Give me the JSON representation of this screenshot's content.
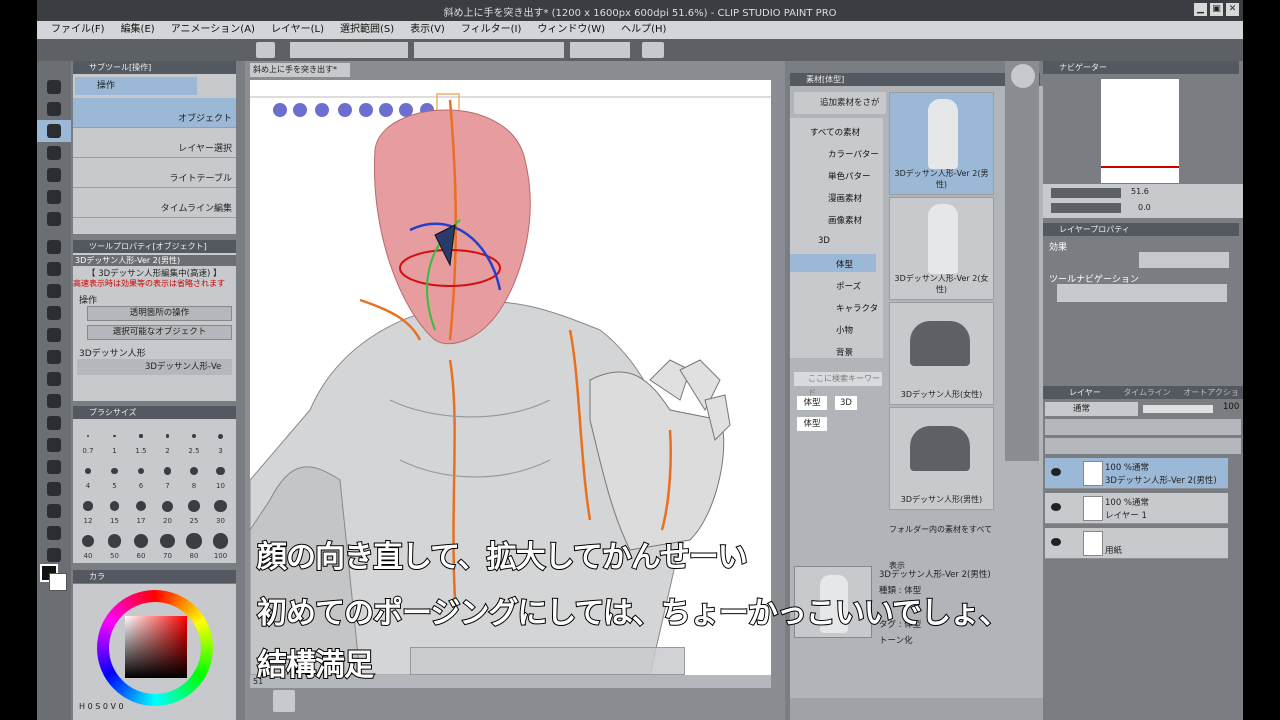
{
  "window": {
    "title": "斜め上に手を突き出す* (1200 x 1600px 600dpi 51.6%) - CLIP STUDIO PAINT PRO"
  },
  "menu": [
    "ファイル(F)",
    "編集(E)",
    "アニメーション(A)",
    "レイヤー(L)",
    "選択範囲(S)",
    "表示(V)",
    "フィルター(I)",
    "ウィンドウ(W)",
    "ヘルプ(H)"
  ],
  "subtool_panel": {
    "tab": "サブツール[操作]",
    "group": "操作",
    "items": [
      "オブジェクト",
      "レイヤー選択",
      "ライトテーブル",
      "タイムライン編集"
    ]
  },
  "tool_property": {
    "tab": "ツールプロパティ[オブジェクト]",
    "model_name": "3Dデッサン人形-Ver 2(男性)",
    "status_line1": "【 3Dデッサン人形編集中(高速) 】",
    "status_line2": "高速表示時は効果等の表示は省略されます",
    "section_operation": "操作",
    "btn_transparent": "透明箇所の操作",
    "btn_selectable": "選択可能なオブジェクト",
    "section_doll": "3Dデッサン人形",
    "doll_row": "3Dデッサン人形-Ve"
  },
  "brush_size": {
    "tab": "ブラシサイズ",
    "values": [
      "0.7",
      "1",
      "1.5",
      "2",
      "2.5",
      "3",
      "4",
      "5",
      "6",
      "7",
      "8",
      "10",
      "12",
      "15",
      "17",
      "20",
      "25",
      "30",
      "40",
      "50",
      "60",
      "70",
      "80",
      "100"
    ]
  },
  "color_panel": {
    "tab": "カラ",
    "h": "0",
    "s": "0",
    "v": "0"
  },
  "canvas_tab": "斜め上に手を突き出す*",
  "canvas_zoom": "51",
  "materials": {
    "tab": "素材[体型]",
    "search_button": "追加素材をさがす",
    "tree": [
      "すべての素材",
      "カラーパター",
      "単色パター",
      "漫画素材",
      "画像素材",
      "3D",
      "体型",
      "ポーズ",
      "キャラクタ",
      "小物",
      "背景"
    ],
    "search_placeholder": "ここに検索キーワード",
    "tags": [
      "体型",
      "3D",
      "体型"
    ],
    "thumbs": [
      "3Dデッサン人形-Ver 2(男性)",
      "3Dデッサン人形-Ver 2(女性)",
      "3Dデッサン人形(女性)",
      "3Dデッサン人形(男性)"
    ],
    "show_all": "フォルダー内の素材をすべて表示",
    "detail_name": "3Dデッサン人形-Ver 2(男性)",
    "detail_type": "種類 : 体型",
    "detail_tag": "タグ : 体型",
    "detail_tone": "トーン化"
  },
  "navigator": {
    "tab": "ナビゲーター",
    "zoom": "51.6",
    "rotate": "0.0"
  },
  "layer_property": {
    "tab": "レイヤープロパティ",
    "effect": "効果",
    "tool_nav": "ツールナビゲーション"
  },
  "layers": {
    "tab": "レイヤー",
    "tab2": "タイムライン",
    "tab3": "オートアクション",
    "blend": "通常",
    "opacity": "100",
    "items": [
      {
        "mode": "100 %通常",
        "name": "3Dデッサン人形-Ver 2(男性)"
      },
      {
        "mode": "100 %通常",
        "name": "レイヤー 1"
      },
      {
        "mode": "",
        "name": "用紙"
      }
    ]
  },
  "subtitles": {
    "line1": "顔の向き直して、拡大してかんせーい",
    "line2": "初めてのポージングにしては、ちょーかっこいいでしょ、",
    "line3": "結構満足"
  }
}
